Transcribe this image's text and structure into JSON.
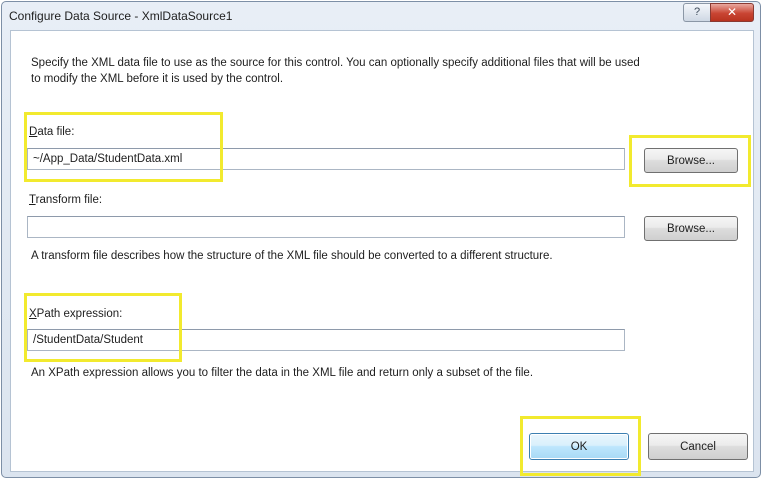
{
  "window": {
    "title": "Configure Data Source - XmlDataSource1",
    "help_glyph": "?",
    "close_glyph": "✕"
  },
  "intro": {
    "line1": "Specify the XML data file to use as the source for this control. You can optionally specify additional files that will be used",
    "line2": "to modify the XML before it is used by the control."
  },
  "data_file": {
    "label_mnemonic": "D",
    "label_rest": "ata file:",
    "value": "~/App_Data/StudentData.xml",
    "browse_label": "Browse..."
  },
  "transform_file": {
    "label_mnemonic": "T",
    "label_rest": "ransform file:",
    "value": "",
    "browse_label": "Browse...",
    "hint": "A transform file describes how the structure of the XML file should be converted to a different structure."
  },
  "xpath": {
    "label_mnemonic": "X",
    "label_rest": "Path expression:",
    "value": "/StudentData/Student",
    "hint": "An XPath expression allows you to filter the data in the XML file and return only a subset of the file."
  },
  "footer": {
    "ok_label": "OK",
    "cancel_label": "Cancel"
  },
  "colors": {
    "highlight": "#f2ea2e",
    "default_button_border": "#3c7fb1",
    "close_button": "#c94533"
  }
}
